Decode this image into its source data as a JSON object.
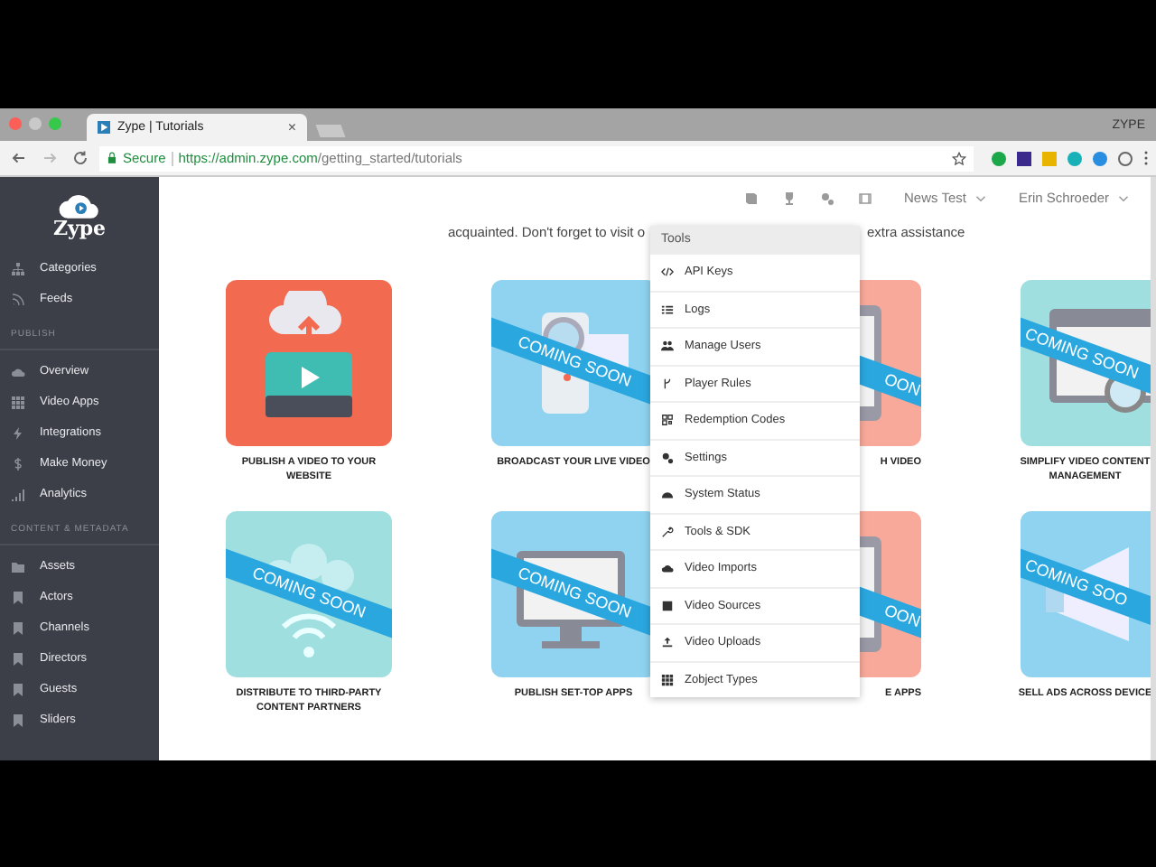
{
  "browser": {
    "tab_title": "Zype | Tutorials",
    "tab_close": "×",
    "profile": "ZYPE",
    "secure_label": "Secure",
    "url_host": "https://admin.zype.com",
    "url_path": "/getting_started/tutorials"
  },
  "sidebar": {
    "logo": "Zype",
    "groups": [
      {
        "items": [
          "Categories",
          "Feeds"
        ]
      },
      {
        "heading": "PUBLISH",
        "items": [
          "Overview",
          "Video Apps",
          "Integrations",
          "Make Money",
          "Analytics"
        ]
      },
      {
        "heading": "CONTENT & METADATA",
        "items": [
          "Assets",
          "Actors",
          "Channels",
          "Directors",
          "Guests",
          "Sliders"
        ]
      }
    ]
  },
  "header": {
    "menus": [
      "News Test",
      "Erin Schroeder"
    ]
  },
  "intro": [
    "acquainted. Don't forget to visit o",
    "extra assistance"
  ],
  "cards": [
    {
      "label": "PUBLISH A VIDEO TO YOUR WEBSITE",
      "color": "#f26a4f",
      "kind": "upload"
    },
    {
      "label": "BROADCAST YOUR LIVE VIDEO",
      "color": "#8fd3f0",
      "kind": "camera",
      "banner": "COMING SOON"
    },
    {
      "label": "H VIDEO",
      "color": "#f8a99a",
      "kind": "screen",
      "banner": "OON"
    },
    {
      "label": "SIMPLIFY VIDEO CONTENT MANAGEMENT",
      "color": "#9fdfe0",
      "kind": "browser",
      "banner": "COMING SOON"
    },
    {
      "label": "DISTRIBUTE TO THIRD-PARTY CONTENT PARTNERS",
      "color": "#9fdfe0",
      "kind": "people",
      "banner": "COMING SOON"
    },
    {
      "label": "PUBLISH SET-TOP APPS",
      "color": "#8fd3f0",
      "kind": "monitor",
      "banner": "COMING SOON"
    },
    {
      "label": "E APPS",
      "color": "#f8a99a",
      "kind": "tablet",
      "banner": "OON"
    },
    {
      "label": "SELL ADS ACROSS DEVICE",
      "color": "#8fd3f0",
      "kind": "megaphone",
      "banner": "COMING SOO"
    }
  ],
  "tools_menu": {
    "title": "Tools",
    "items": [
      "API Keys",
      "Logs",
      "Manage Users",
      "Player Rules",
      "Redemption Codes",
      "Settings",
      "System Status",
      "Tools & SDK",
      "Video Imports",
      "Video Sources",
      "Video Uploads",
      "Zobject Types"
    ]
  }
}
